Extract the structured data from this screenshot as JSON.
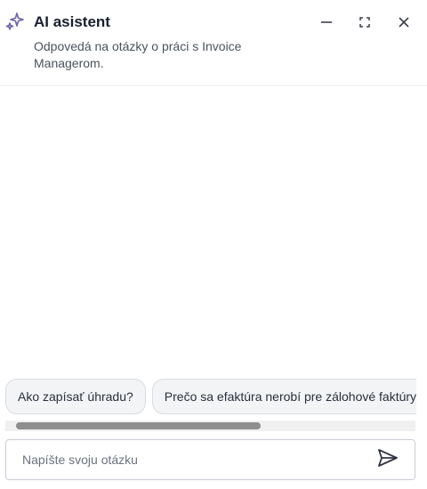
{
  "header": {
    "title": "AI asistent",
    "subtitle": "Odpovedá na otázky o práci s Invoice Managerom.",
    "icon": "sparkle-icon",
    "accent_color": "#6b63a8"
  },
  "window_controls": {
    "minimize_icon": "minimize-icon",
    "maximize_icon": "expand-icon",
    "close_icon": "close-icon"
  },
  "suggestions": [
    {
      "label": "Ako zapísať úhradu?"
    },
    {
      "label": "Prečo sa efaktúra nerobí pre zálohové faktúry?"
    }
  ],
  "suggestions_scroll_position": 0.0,
  "composer": {
    "placeholder": "Napíšte svoju otázku",
    "value": "",
    "send_icon": "send-icon"
  }
}
